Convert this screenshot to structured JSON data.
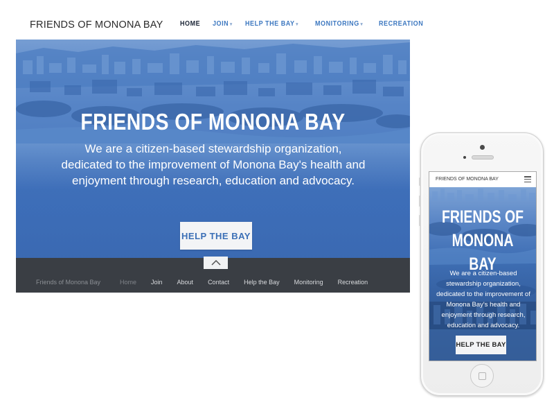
{
  "desktop": {
    "nav": {
      "logo": "FRIENDS OF MONONA BAY",
      "items": [
        {
          "label": "HOME",
          "has_dropdown": false,
          "active": true
        },
        {
          "label": "JOIN",
          "has_dropdown": true,
          "active": false
        },
        {
          "label": "HELP THE BAY",
          "has_dropdown": true,
          "active": false
        },
        {
          "label": "MONITORING",
          "has_dropdown": true,
          "active": false
        },
        {
          "label": "RECREATION",
          "has_dropdown": false,
          "active": false
        }
      ]
    },
    "hero": {
      "title": "FRIENDS OF MONONA BAY",
      "text": "We are a citizen-based stewardship organization, dedicated to the improvement of Monona Bay's health and enjoyment through research, education and advocacy.",
      "button_label": "HELP THE BAY"
    },
    "footer": {
      "brand": "Friends of Monona Bay",
      "links": [
        "Home",
        "Join",
        "About",
        "Contact",
        "Help the Bay",
        "Monitoring",
        "Recreation"
      ]
    }
  },
  "mobile": {
    "nav": {
      "logo": "FRIENDS OF MONONA BAY"
    },
    "hero": {
      "title_line1": "FRIENDS OF",
      "title_line2": "MONONA BAY",
      "text": "We are a citizen-based stewardship organization, dedicated to the improvement of Monona Bay's health and enjoyment through research, education and advocacy.",
      "button_label": "HELP THE BAY"
    }
  },
  "colors": {
    "brand_blue": "#3d78c0",
    "hero_blue": "#3e6fb8",
    "footer_dark": "#3a3e44"
  },
  "icons": [
    "chevron-up-icon",
    "hamburger-menu-icon",
    "dropdown-caret-icon"
  ]
}
